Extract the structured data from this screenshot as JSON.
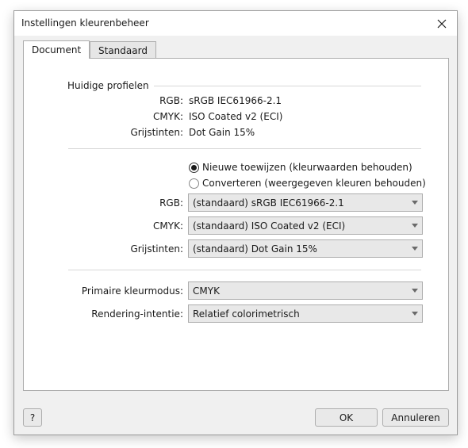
{
  "window": {
    "title": "Instellingen kleurenbeheer"
  },
  "tabs": [
    {
      "label": "Document"
    },
    {
      "label": "Standaard"
    }
  ],
  "current_profiles": {
    "title": "Huidige profielen",
    "rows": [
      {
        "label": "RGB:",
        "value": "sRGB IEC61966-2.1"
      },
      {
        "label": "CMYK:",
        "value": "ISO Coated v2 (ECI)"
      },
      {
        "label": "Grijstinten:",
        "value": "Dot Gain 15%"
      }
    ]
  },
  "assign": {
    "options": [
      {
        "label": "Nieuwe toewijzen (kleurwaarden behouden)",
        "selected": true
      },
      {
        "label": "Converteren (weergegeven kleuren behouden)",
        "selected": false
      }
    ],
    "profiles": [
      {
        "label": "RGB:",
        "value": "(standaard) sRGB IEC61966-2.1"
      },
      {
        "label": "CMYK:",
        "value": "(standaard) ISO Coated v2 (ECI)"
      },
      {
        "label": "Grijstinten:",
        "value": "(standaard) Dot Gain 15%"
      }
    ]
  },
  "mode": {
    "primary_label": "Primaire kleurmodus:",
    "primary_value": "CMYK",
    "intent_label": "Rendering-intentie:",
    "intent_value": "Relatief colorimetrisch"
  },
  "footer": {
    "help_label": "?",
    "ok_label": "OK",
    "cancel_label": "Annuleren"
  },
  "icons": {
    "close": "close-icon",
    "dropdown": "chevron-down-icon"
  }
}
